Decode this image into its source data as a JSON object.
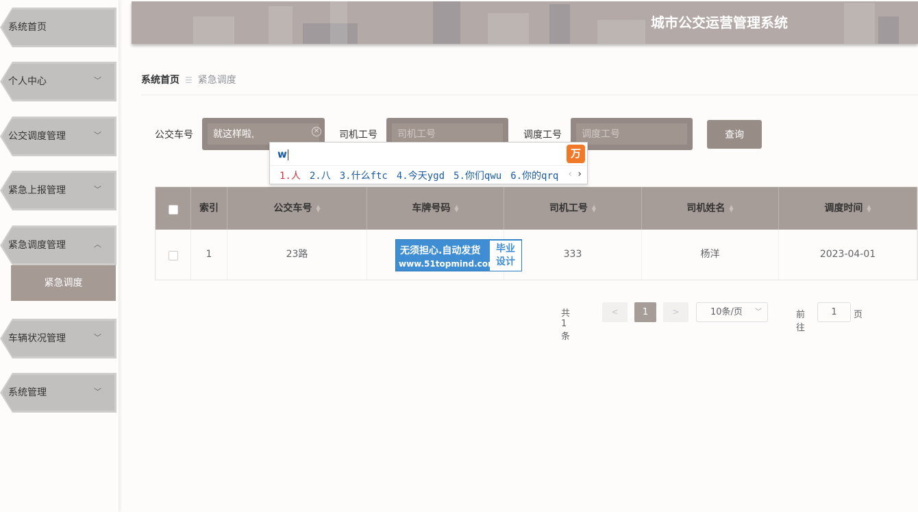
{
  "header": {
    "title": "城市公交运营管理系统"
  },
  "sidebar": {
    "items": [
      {
        "label": "系统首页",
        "arrow": ""
      },
      {
        "label": "个人中心",
        "arrow": "﹀"
      },
      {
        "label": "公交调度管理",
        "arrow": "﹀"
      },
      {
        "label": "紧急上报管理",
        "arrow": "﹀"
      },
      {
        "label": "紧急调度管理",
        "arrow": "︿"
      },
      {
        "label": "车辆状况管理",
        "arrow": "﹀"
      },
      {
        "label": "系统管理",
        "arrow": "﹀"
      }
    ],
    "active_sub_item": "紧急调度"
  },
  "breadcrumb": {
    "home": "系统首页",
    "separator": "☰",
    "current": "紧急调度"
  },
  "search": {
    "bus_no_label": "公交车号",
    "bus_no_value": "就这样啦,",
    "driver_id_label": "司机工号",
    "driver_id_placeholder": "司机工号",
    "dispatch_id_label": "调度工号",
    "dispatch_id_placeholder": "调度工号",
    "query_button": "查询"
  },
  "ime": {
    "composition": "w",
    "candidates": [
      "1.人",
      "2.八",
      "3.什么ftc",
      "4.今天ygd",
      "5.你们qwu",
      "6.你的qrq"
    ],
    "logo": "万"
  },
  "table": {
    "columns": [
      "索引",
      "公交车号",
      "车牌号码",
      "司机工号",
      "司机姓名",
      "调度时间"
    ],
    "rows": [
      {
        "index": "1",
        "bus_no": "23路",
        "plate": "",
        "driver_id": "333",
        "driver_name": "杨洋",
        "dispatch_time": "2023-04-01"
      }
    ]
  },
  "watermark": {
    "line1": "无须担心.自动发货",
    "line2": "www.51topmind.com",
    "box_line1": "毕业",
    "box_line2": "设计"
  },
  "pagination": {
    "total": "共 1 条",
    "prev": "<",
    "current": "1",
    "next": ">",
    "page_size": "10条/页",
    "goto_label": "前往",
    "goto_value": "1",
    "page_suffix": "页"
  },
  "colors": {
    "accent": "#a69c98",
    "header_bg": "#b3a9a6",
    "ime_text": "#1a5aa0",
    "ime_first": "#d0333a",
    "watermark": "#3f8ed3"
  }
}
